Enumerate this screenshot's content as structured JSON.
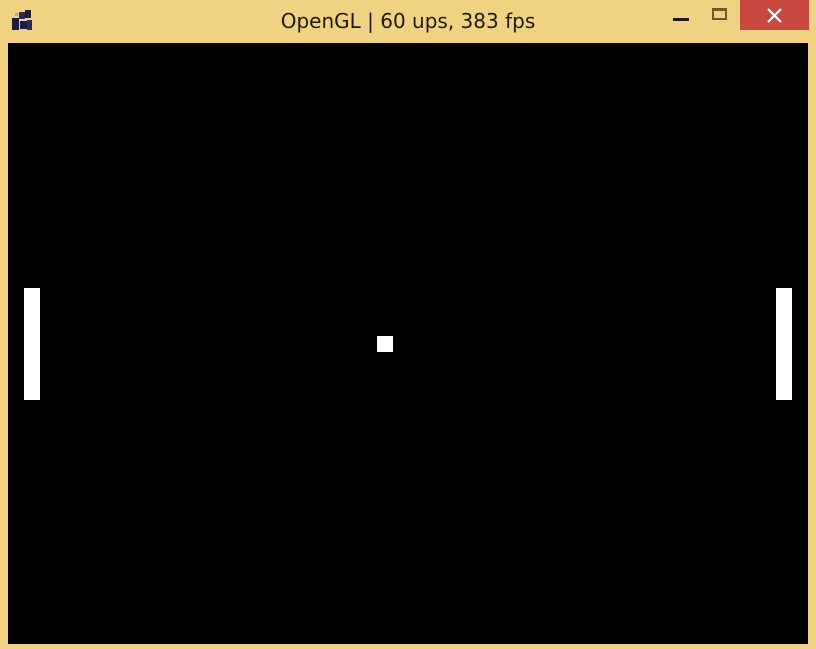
{
  "window": {
    "title": "OpenGL | 60 ups, 383 fps",
    "icon": "java-app-icon",
    "frame_color": "#f0d382",
    "close_color": "#c9483f"
  },
  "controls": {
    "minimize": "minimize-icon",
    "maximize": "maximize-icon",
    "close": "close-icon"
  },
  "game": {
    "name": "pong",
    "background": "#000000",
    "foreground": "#ffffff",
    "objects": [
      "left-paddle",
      "right-paddle",
      "ball"
    ]
  }
}
